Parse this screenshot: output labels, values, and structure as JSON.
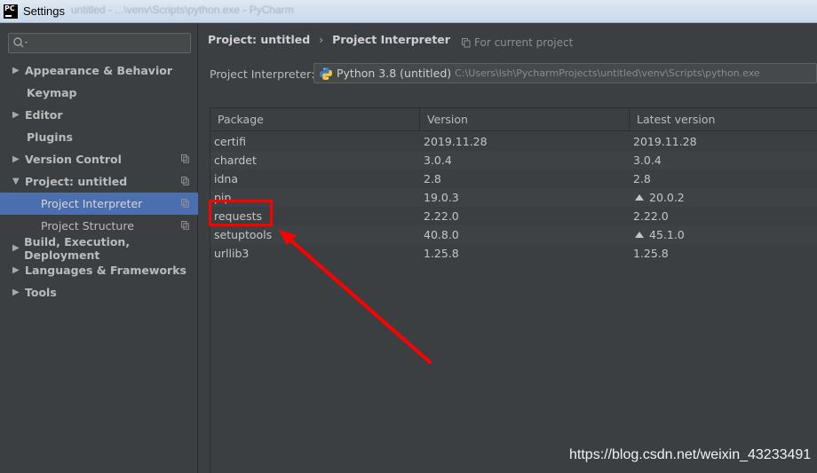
{
  "window": {
    "title": "Settings",
    "ghost_title": "untitled - ...\\venv\\Scripts\\python.exe - PyCharm"
  },
  "sidebar": {
    "search": {
      "value": "",
      "placeholder": ""
    },
    "items": [
      {
        "label": "Appearance & Behavior",
        "bold": true,
        "arrow": "right",
        "copy_icon": false
      },
      {
        "label": "Keymap",
        "bold": true,
        "arrow": "none",
        "copy_icon": false
      },
      {
        "label": "Editor",
        "bold": true,
        "arrow": "right",
        "copy_icon": false
      },
      {
        "label": "Plugins",
        "bold": true,
        "arrow": "none",
        "copy_icon": false
      },
      {
        "label": "Version Control",
        "bold": true,
        "arrow": "right",
        "copy_icon": true
      },
      {
        "label": "Project: untitled",
        "bold": true,
        "arrow": "down",
        "copy_icon": true
      },
      {
        "label": "Project Interpreter",
        "bold": false,
        "child": true,
        "selected": true,
        "copy_icon": true
      },
      {
        "label": "Project Structure",
        "bold": false,
        "child": true,
        "copy_icon": true
      },
      {
        "label": "Build, Execution, Deployment",
        "bold": true,
        "arrow": "right",
        "copy_icon": false
      },
      {
        "label": "Languages & Frameworks",
        "bold": true,
        "arrow": "right",
        "copy_icon": false
      },
      {
        "label": "Tools",
        "bold": true,
        "arrow": "right",
        "copy_icon": false
      }
    ]
  },
  "main": {
    "breadcrumb": [
      "Project: untitled",
      "Project Interpreter"
    ],
    "breadcrumb_separator": "›",
    "for_current_project": "For current project",
    "interpreter_label": "Project Interpreter:",
    "interpreter_name": "Python 3.8 (untitled)",
    "interpreter_path": "C:\\Users\\lsh\\PycharmProjects\\untitled\\venv\\Scripts\\python.exe",
    "table": {
      "columns": [
        "Package",
        "Version",
        "Latest version"
      ],
      "rows": [
        {
          "package": "certifi",
          "version": "2019.11.28",
          "latest": "2019.11.28",
          "upgrade": false
        },
        {
          "package": "chardet",
          "version": "3.0.4",
          "latest": "3.0.4",
          "upgrade": false
        },
        {
          "package": "idna",
          "version": "2.8",
          "latest": "2.8",
          "upgrade": false
        },
        {
          "package": "pip",
          "version": "19.0.3",
          "latest": "20.0.2",
          "upgrade": true
        },
        {
          "package": "requests",
          "version": "2.22.0",
          "latest": "2.22.0",
          "upgrade": false
        },
        {
          "package": "setuptools",
          "version": "40.8.0",
          "latest": "45.1.0",
          "upgrade": true
        },
        {
          "package": "urllib3",
          "version": "1.25.8",
          "latest": "1.25.8",
          "upgrade": false
        }
      ]
    }
  },
  "annotation": {
    "highlighted_package": "requests",
    "color": "#ff0000"
  },
  "watermark": "https://blog.csdn.net/weixin_43233491",
  "colors": {
    "background": "#3c3f41",
    "selection": "#4b6eaf",
    "text": "#bbbbbb"
  }
}
